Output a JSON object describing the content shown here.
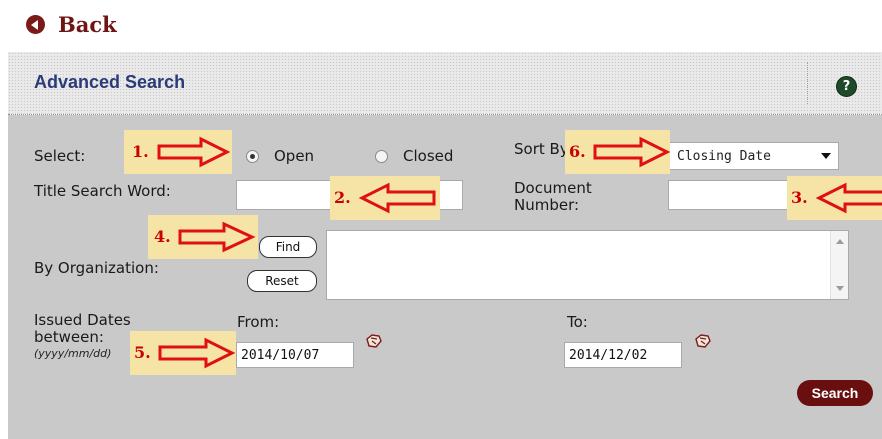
{
  "back": {
    "label": "Back"
  },
  "panel": {
    "title": "Advanced Search",
    "help": "?"
  },
  "form": {
    "select_label": "Select:",
    "open_label": "Open",
    "closed_label": "Closed",
    "selected_status": "Open",
    "sort_label": "Sort By",
    "sort_value": "Closing Date",
    "title_search_label": "Title Search Word:",
    "title_search_value": "",
    "document_number_label_1": "Document",
    "document_number_label_2": "Number:",
    "document_number_value": "",
    "org_label": "By Organization:",
    "find_label": "Find",
    "reset_label": "Reset",
    "org_value": "",
    "issued_label_1": "Issued Dates",
    "issued_label_2": "between:",
    "issued_format": "(yyyy/mm/dd)",
    "from_label": "From:",
    "to_label": "To:",
    "from_value": "2014/10/07",
    "to_value": "2014/12/02",
    "search_label": "Search"
  },
  "annotations": [
    {
      "num": "1."
    },
    {
      "num": "2."
    },
    {
      "num": "3."
    },
    {
      "num": "4."
    },
    {
      "num": "5."
    },
    {
      "num": "6."
    }
  ],
  "colors": {
    "annotation_bg": "#f5e4a6",
    "annotation_text": "#cc0000",
    "search_button": "#6a0f0f",
    "title": "#2a3b78"
  }
}
